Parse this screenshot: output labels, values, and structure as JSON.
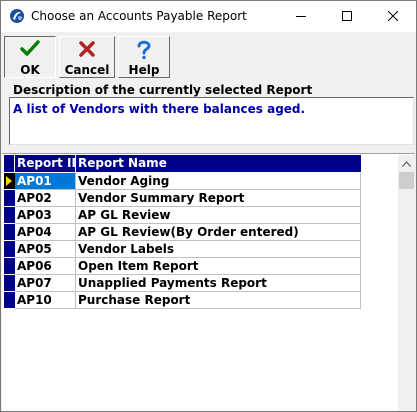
{
  "window": {
    "title": "Choose an Accounts Payable Report"
  },
  "toolbar": {
    "ok_label": "OK",
    "cancel_label": "Cancel",
    "help_label": "Help"
  },
  "description": {
    "label": "Description of the currently selected Report",
    "text": "A list of Vendors with there balances aged."
  },
  "grid": {
    "columns": [
      "Report ID",
      "Report Name"
    ],
    "rows": [
      {
        "id": "AP01",
        "name": "Vendor Aging"
      },
      {
        "id": "AP02",
        "name": "Vendor Summary Report"
      },
      {
        "id": "AP03",
        "name": "AP GL Review"
      },
      {
        "id": "AP04",
        "name": "AP GL Review(By Order entered)"
      },
      {
        "id": "AP05",
        "name": "Vendor Labels"
      },
      {
        "id": "AP06",
        "name": "Open Item Report"
      },
      {
        "id": "AP07",
        "name": "Unapplied Payments Report"
      },
      {
        "id": "AP10",
        "name": "Purchase Report"
      }
    ],
    "selected_index": 0
  },
  "colors": {
    "header_bg": "#00008b",
    "selection": "#0078d7",
    "description_text": "#0000aa",
    "ok_icon": "#008000",
    "cancel_icon": "#b22222",
    "help_icon": "#1e6fd0"
  },
  "icons": {
    "ok": "checkmark-icon",
    "cancel": "x-icon",
    "help": "question-icon"
  }
}
